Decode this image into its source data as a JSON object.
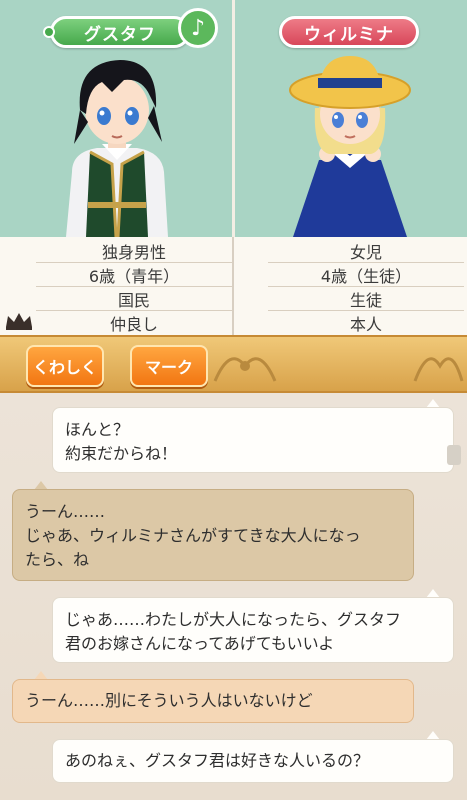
{
  "left_character": {
    "name": "グスタフ",
    "info": [
      "独身男性",
      "6歳（青年）",
      "国民",
      "仲良し"
    ]
  },
  "right_character": {
    "name": "ウィルミナ",
    "info": [
      "女児",
      "4歳（生徒）",
      "生徒",
      "本人"
    ]
  },
  "music_icon": "♪",
  "buttons": {
    "detail": "くわしく",
    "mark": "マーク"
  },
  "chat": [
    {
      "lines": [
        "ほんと？",
        "約束だからね！"
      ]
    },
    {
      "lines": [
        "うーん……",
        "じゃあ、ウィルミナさんがすてきな大人になっ",
        "たら、ね"
      ]
    },
    {
      "lines": [
        "じゃあ……わたしが大人になったら、グスタフ",
        "君のお嫁さんになってあげてもいいよ"
      ]
    },
    {
      "lines": [
        "うーん……別にそういう人はいないけど"
      ]
    },
    {
      "lines": [
        "あのねぇ、グスタフ君は好きな人いるの？"
      ]
    }
  ],
  "colors": {
    "name_green": "#46a94c",
    "name_red": "#d8475a",
    "button_orange": "#f27612",
    "panel_bg": "#a9d4c4"
  }
}
